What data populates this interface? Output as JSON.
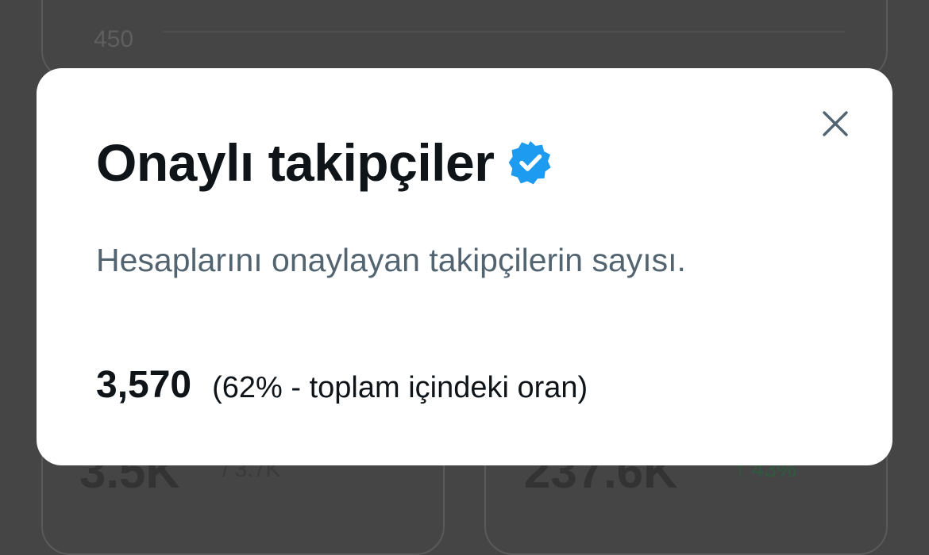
{
  "background": {
    "axis_label": "450",
    "left_card": {
      "value": "3.5K",
      "sub": "/ 3.7K"
    },
    "right_card": {
      "value": "237.6K",
      "change": "↑ 43%"
    }
  },
  "modal": {
    "title": "Onaylı takipçiler",
    "description": "Hesaplarını onaylayan takipçilerin sayısı.",
    "stat_value": "3,570",
    "stat_ratio": "(62% - toplam içindeki oran)",
    "close_icon": "close-icon",
    "badge_icon": "verified-badge-icon"
  },
  "colors": {
    "backdrop": "#454545",
    "modal_bg": "#ffffff",
    "title": "#0f1419",
    "secondary_text": "#536471",
    "verified_blue": "#1d9bf0"
  }
}
